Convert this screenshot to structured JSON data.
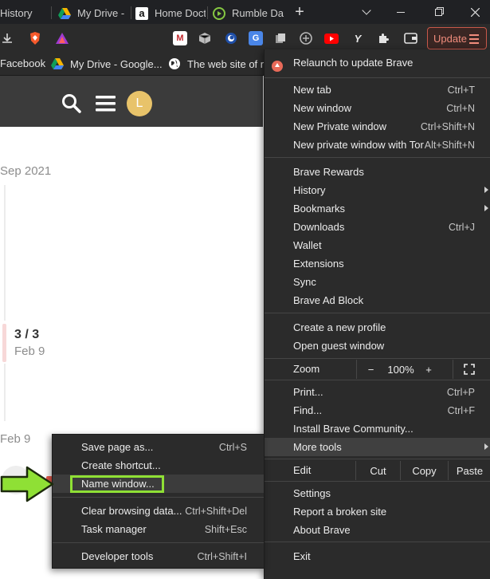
{
  "tabs": [
    {
      "title": "History",
      "icon": "history-icon"
    },
    {
      "title": "My Drive -",
      "icon": "google-drive-icon"
    },
    {
      "title": "Home Doct",
      "icon": "amazon-icon"
    },
    {
      "title": "Rumble Da",
      "icon": "rumble-icon"
    }
  ],
  "new_tab_symbol": "+",
  "update_button": {
    "label": "Update"
  },
  "bookmarks": [
    {
      "label": "Facebook"
    },
    {
      "label": "My Drive - Google..."
    },
    {
      "label": "The web site of re"
    }
  ],
  "page": {
    "avatar_letter": "L",
    "date1": "Sep 2021",
    "count": "3 / 3",
    "date2": "Feb 9",
    "date3": "Feb 9"
  },
  "main_menu": {
    "relaunch": "Relaunch to update Brave",
    "new_tab": {
      "label": "New tab",
      "shortcut": "Ctrl+T"
    },
    "new_window": {
      "label": "New window",
      "shortcut": "Ctrl+N"
    },
    "new_private": {
      "label": "New Private window",
      "shortcut": "Ctrl+Shift+N"
    },
    "new_private_tor": {
      "label": "New private window with Tor",
      "shortcut": "Alt+Shift+N"
    },
    "rewards": "Brave Rewards",
    "history": "History",
    "bookmarks": "Bookmarks",
    "downloads": {
      "label": "Downloads",
      "shortcut": "Ctrl+J"
    },
    "wallet": "Wallet",
    "extensions": "Extensions",
    "sync": "Sync",
    "adblock": "Brave Ad Block",
    "create_profile": "Create a new profile",
    "guest_window": "Open guest window",
    "zoom": {
      "label": "Zoom",
      "minus": "−",
      "value": "100%",
      "plus": "+"
    },
    "print": {
      "label": "Print...",
      "shortcut": "Ctrl+P"
    },
    "find": {
      "label": "Find...",
      "shortcut": "Ctrl+F"
    },
    "community": "Install Brave Community...",
    "more_tools": "More tools",
    "edit": {
      "label": "Edit",
      "cut": "Cut",
      "copy": "Copy",
      "paste": "Paste"
    },
    "settings": "Settings",
    "report": "Report a broken site",
    "about": "About Brave",
    "exit": "Exit"
  },
  "sub_menu": {
    "save_page": {
      "label": "Save page as...",
      "shortcut": "Ctrl+S"
    },
    "create_shortcut": {
      "label": "Create shortcut..."
    },
    "name_window": {
      "label": "Name window..."
    },
    "clear_data": {
      "label": "Clear browsing data...",
      "shortcut": "Ctrl+Shift+Del"
    },
    "task_manager": {
      "label": "Task manager",
      "shortcut": "Shift+Esc"
    },
    "dev_tools": {
      "label": "Developer tools",
      "shortcut": "Ctrl+Shift+I"
    }
  },
  "colors": {
    "menu_bg": "#2b2b2b",
    "highlight": "#404040",
    "update_accent": "#f08c7c",
    "annotation_green": "#8fe035"
  }
}
